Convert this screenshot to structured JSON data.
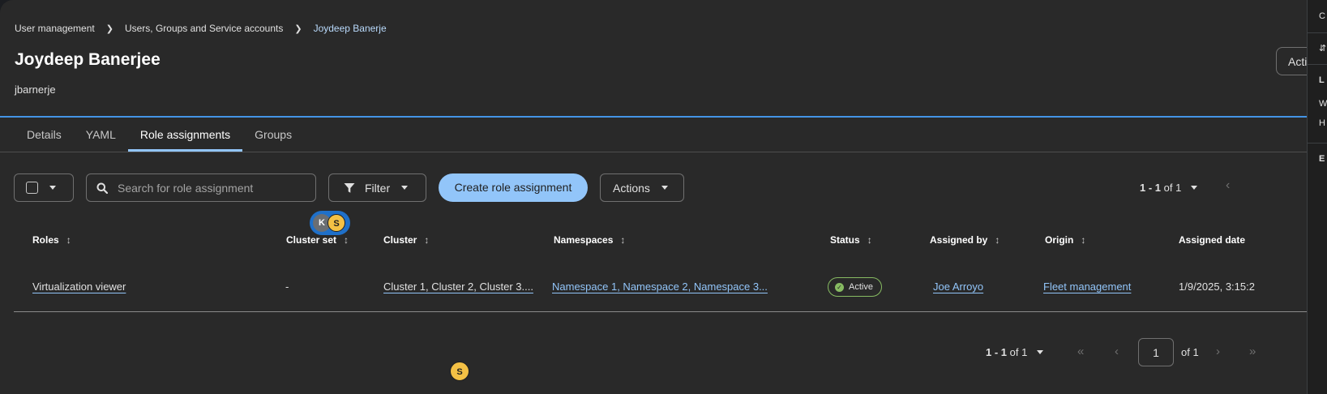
{
  "breadcrumb": [
    "User management",
    "Users, Groups and Service accounts",
    "Joydeep Banerje"
  ],
  "header": {
    "title": "Joydeep Banerjee",
    "subtitle": "jbarnerje",
    "actions_label": "Actions"
  },
  "tabs": [
    {
      "label": "Details",
      "active": false
    },
    {
      "label": "YAML",
      "active": false
    },
    {
      "label": "Role assignments",
      "active": true
    },
    {
      "label": "Groups",
      "active": false
    }
  ],
  "toolbar": {
    "search_placeholder": "Search for role assignment",
    "filter_label": "Filter",
    "create_label": "Create role assignment",
    "actions_label": "Actions"
  },
  "pagination_top": {
    "range": "1 - 1",
    "of_text": "of",
    "total": "1"
  },
  "collaborators": {
    "group": [
      "K",
      "S"
    ],
    "solo": "S"
  },
  "table": {
    "columns": [
      "Roles",
      "Cluster set",
      "Cluster",
      "Namespaces",
      "Status",
      "Assigned by",
      "Origin",
      "Assigned date"
    ],
    "rows": [
      {
        "role": "Virtualization viewer",
        "cluster_set": "-",
        "cluster": "Cluster 1, Cluster 2, Cluster 3....",
        "namespaces": "Namespace 1, Namespace 2, Namespace 3...",
        "status": "Active",
        "assigned_by": "Joe Arroyo",
        "origin": "Fleet management",
        "assigned_date": "1/9/2025, 3:15:2"
      }
    ]
  },
  "pagination_bottom": {
    "range": "1 - 1",
    "of_text": "of",
    "total": "1",
    "page": "1",
    "of_pages": "of 1"
  },
  "right_drawer": {
    "items": [
      "C",
      "⇵",
      "L",
      "W",
      "H",
      "E"
    ]
  },
  "colors": {
    "accent": "#92c5f9",
    "status_active": "#87bb62",
    "header_line": "#4394e5",
    "background": "#292929"
  }
}
